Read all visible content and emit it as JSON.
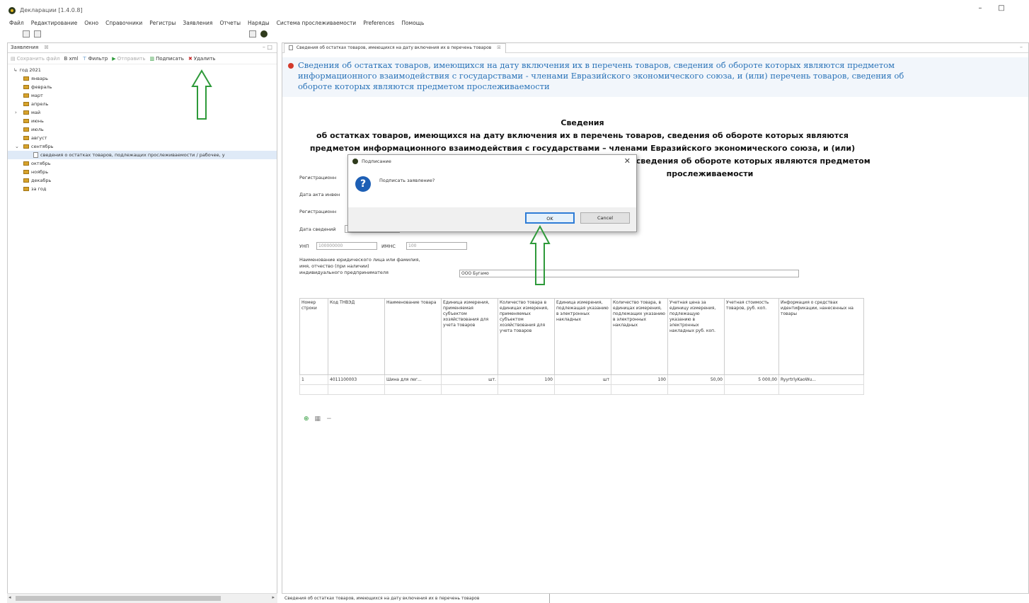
{
  "window": {
    "title": "Декларации [1.4.0.8]",
    "minimize": "–",
    "maximize": "□"
  },
  "menu": [
    "Файл",
    "Редактирование",
    "Окно",
    "Справочники",
    "Регистры",
    "Заявления",
    "Отчеты",
    "Наряды",
    "Система прослеживаемости",
    "Preferences",
    "Помощь"
  ],
  "left_panel": {
    "tab_label": "Заявления",
    "tab_close": "☒",
    "panel_controls": "– □",
    "toolbar": {
      "save_file": "Сохранить файл",
      "xml": "В xml",
      "filter": "Фильтр",
      "send": "Отправить",
      "sign": "Подписать",
      "delete": "Удалить"
    },
    "tree": {
      "root": "год 2021",
      "months": [
        "январь",
        "февраль",
        "март",
        "апрель",
        "май",
        "июнь",
        "июль",
        "август",
        "сентябрь"
      ],
      "selected_doc": "сведения о остатках товаров, подлежащих прослеживаемости / рабочее, у",
      "after": [
        "октябрь",
        "ноябрь",
        "декабрь",
        "за год"
      ]
    }
  },
  "editor": {
    "tab_label": "Сведения об остатках товаров, имеющихся на дату включения их в перечень товаров",
    "tab_close": "☒",
    "header_text": "Сведения об остатках товаров, имеющихся на дату включения их в перечень товаров, сведения об обороте которых являются предметом информационного взаимодействия с государствами - членами Евразийского экономического союза, и (или) перечень товаров, сведения об обороте которых являются предметом прослеживаемости",
    "form_title_1": "Сведения",
    "form_title_2": "об остатках товаров, имеющихся на дату включения их в перечень товаров, сведения об обороте которых являются",
    "form_title_3": "предметом информационного взаимодействия с государствами – членами Евразийского экономического союза, и (или)",
    "form_title_4": "перечень товаров, сведения об обороте которых являются предметом прослеживаемости",
    "fields": {
      "reg_label_1": "Регистрационн",
      "act_date_label": "Дата акта инвен",
      "reg_label_2": "Регистрационн",
      "info_date_label": "Дата сведений",
      "info_date_value": "",
      "unp_label": "УНП",
      "unp_value": "100000000",
      "imns_label": "ИМНС",
      "imns_value": "100",
      "name_label_1": "Наименование юридического лица или фамилия,",
      "name_label_2": "имя, отчество (при наличии)",
      "name_label_3": "индивидуального предпринимателя",
      "name_value": "ООО Бугамо"
    },
    "table": {
      "headers": [
        "Номер строки",
        "Код ТНВЭД",
        "Наименование товара",
        "Единица измерения, применяемая субъектом хозяйствования для учета товаров",
        "Количество товара в единицах измерения, применяемых субъектом хозяйствования для учета товаров",
        "Единица измерения, подлежащая указанию в электронных накладных",
        "Количество товара, в единицах измерения, подлежащих указанию в электронных накладных",
        "Учетная цена за единицу измерения, подлежащую указанию в электронных накладных руб. коп.",
        "Учетная стоимость товаров, руб. коп.",
        "Информация о средствах идентификации, нанесенных на товары"
      ],
      "rows": [
        [
          "1",
          "4011100003",
          "Шина для лег...",
          "шт.",
          "100",
          "шт",
          "100",
          "50,00",
          "5 000,00",
          "RyyrtrlyKaoWu..."
        ]
      ],
      "add_icon": "⊕",
      "copy_icon": "▦",
      "remove_icon": "−"
    }
  },
  "status_bar": {
    "text": "Сведения об остатках товаров, имеющихся на дату включения их в перечень товаров"
  },
  "dialog": {
    "title": "Подписание",
    "close": "✕",
    "icon_glyph": "?",
    "message": "Подписать заявление?",
    "ok_label": "OK",
    "cancel_label": "Cancel"
  },
  "colors": {
    "header_text": "#2a73b8",
    "arrow": "#2e9a3a",
    "ok_border": "#2e7cd6"
  }
}
